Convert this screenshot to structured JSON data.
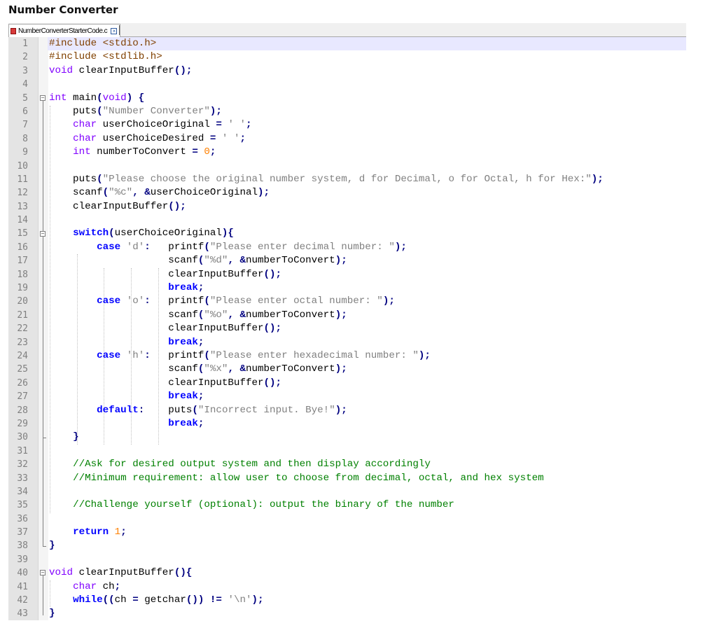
{
  "header": {
    "title": "Number Converter"
  },
  "tab": {
    "filename": "NumberConverterStarterCode.c"
  },
  "lines": [
    {
      "n": "1",
      "html": "<span class=\"d\">#include &lt;stdio.h&gt;</span>"
    },
    {
      "n": "2",
      "html": "<span class=\"d\">#include &lt;stdlib.h&gt;</span>"
    },
    {
      "n": "3",
      "html": "<span class=\"t\">void</span> clearInputBuffer<span class=\"p\">();</span>"
    },
    {
      "n": "4",
      "html": ""
    },
    {
      "n": "5",
      "html": "<span class=\"t\">int</span> main<span class=\"p\">(</span><span class=\"t\">void</span><span class=\"p\">)</span> <span class=\"p\">{</span>"
    },
    {
      "n": "6",
      "html": "    puts<span class=\"p\">(</span><span class=\"s\">\"Number Converter\"</span><span class=\"p\">);</span>"
    },
    {
      "n": "7",
      "html": "    <span class=\"t\">char</span> userChoiceOriginal <span class=\"p\">=</span> <span class=\"s\">' '</span><span class=\"p\">;</span>"
    },
    {
      "n": "8",
      "html": "    <span class=\"t\">char</span> userChoiceDesired <span class=\"p\">=</span> <span class=\"s\">' '</span><span class=\"p\">;</span>"
    },
    {
      "n": "9",
      "html": "    <span class=\"t\">int</span> numberToConvert <span class=\"p\">=</span> <span class=\"n\">0</span><span class=\"p\">;</span>"
    },
    {
      "n": "10",
      "html": ""
    },
    {
      "n": "11",
      "html": "    puts<span class=\"p\">(</span><span class=\"s\">\"Please choose the original number system, d for Decimal, o for Octal, h for Hex:\"</span><span class=\"p\">);</span>"
    },
    {
      "n": "12",
      "html": "    scanf<span class=\"p\">(</span><span class=\"s\">\"%c\"</span><span class=\"p\">,</span> <span class=\"p\">&amp;</span>userChoiceOriginal<span class=\"p\">);</span>"
    },
    {
      "n": "13",
      "html": "    clearInputBuffer<span class=\"p\">();</span>"
    },
    {
      "n": "14",
      "html": ""
    },
    {
      "n": "15",
      "html": "    <span class=\"k\">switch</span><span class=\"p\">(</span>userChoiceOriginal<span class=\"p\">){</span>"
    },
    {
      "n": "16",
      "html": "        <span class=\"k\">case</span> <span class=\"s\">'d'</span><span class=\"p\">:</span>   printf<span class=\"p\">(</span><span class=\"s\">\"Please enter decimal number: \"</span><span class=\"p\">);</span>"
    },
    {
      "n": "17",
      "html": "                    scanf<span class=\"p\">(</span><span class=\"s\">\"%d\"</span><span class=\"p\">,</span> <span class=\"p\">&amp;</span>numberToConvert<span class=\"p\">);</span>"
    },
    {
      "n": "18",
      "html": "                    clearInputBuffer<span class=\"p\">();</span>"
    },
    {
      "n": "19",
      "html": "                    <span class=\"k\">break</span><span class=\"p\">;</span>"
    },
    {
      "n": "20",
      "html": "        <span class=\"k\">case</span> <span class=\"s\">'o'</span><span class=\"p\">:</span>   printf<span class=\"p\">(</span><span class=\"s\">\"Please enter octal number: \"</span><span class=\"p\">);</span>"
    },
    {
      "n": "21",
      "html": "                    scanf<span class=\"p\">(</span><span class=\"s\">\"%o\"</span><span class=\"p\">,</span> <span class=\"p\">&amp;</span>numberToConvert<span class=\"p\">);</span>"
    },
    {
      "n": "22",
      "html": "                    clearInputBuffer<span class=\"p\">();</span>"
    },
    {
      "n": "23",
      "html": "                    <span class=\"k\">break</span><span class=\"p\">;</span>"
    },
    {
      "n": "24",
      "html": "        <span class=\"k\">case</span> <span class=\"s\">'h'</span><span class=\"p\">:</span>   printf<span class=\"p\">(</span><span class=\"s\">\"Please enter hexadecimal number: \"</span><span class=\"p\">);</span>"
    },
    {
      "n": "25",
      "html": "                    scanf<span class=\"p\">(</span><span class=\"s\">\"%x\"</span><span class=\"p\">,</span> <span class=\"p\">&amp;</span>numberToConvert<span class=\"p\">);</span>"
    },
    {
      "n": "26",
      "html": "                    clearInputBuffer<span class=\"p\">();</span>"
    },
    {
      "n": "27",
      "html": "                    <span class=\"k\">break</span><span class=\"p\">;</span>"
    },
    {
      "n": "28",
      "html": "        <span class=\"k\">default</span><span class=\"p\">:</span>    puts<span class=\"p\">(</span><span class=\"s\">\"Incorrect input. Bye!\"</span><span class=\"p\">);</span>"
    },
    {
      "n": "29",
      "html": "                    <span class=\"k\">break</span><span class=\"p\">;</span>"
    },
    {
      "n": "30",
      "html": "    <span class=\"p\">}</span>"
    },
    {
      "n": "31",
      "html": ""
    },
    {
      "n": "32",
      "html": "    <span class=\"c\">//Ask for desired output system and then display accordingly</span>"
    },
    {
      "n": "33",
      "html": "    <span class=\"c\">//Minimum requirement: allow user to choose from decimal, octal, and hex system</span>"
    },
    {
      "n": "34",
      "html": ""
    },
    {
      "n": "35",
      "html": "    <span class=\"c\">//Challenge yourself (optional): output the binary of the number</span>"
    },
    {
      "n": "36",
      "html": ""
    },
    {
      "n": "37",
      "html": "    <span class=\"k\">return</span> <span class=\"n\">1</span><span class=\"p\">;</span>"
    },
    {
      "n": "38",
      "html": "<span class=\"p\">}</span>"
    },
    {
      "n": "39",
      "html": ""
    },
    {
      "n": "40",
      "html": "<span class=\"t\">void</span> clearInputBuffer<span class=\"p\">(){</span>"
    },
    {
      "n": "41",
      "html": "    <span class=\"t\">char</span> ch<span class=\"p\">;</span>"
    },
    {
      "n": "42",
      "html": "    <span class=\"k\">while</span><span class=\"p\">((</span>ch <span class=\"p\">=</span> getchar<span class=\"p\">())</span> <span class=\"p\">!=</span> <span class=\"s\">'\\n'</span><span class=\"p\">);</span>"
    },
    {
      "n": "43",
      "html": "<span class=\"p\">}</span>"
    }
  ]
}
